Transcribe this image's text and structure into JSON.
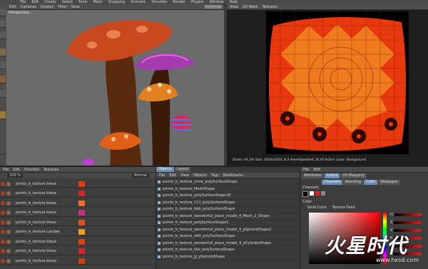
{
  "top_menu": [
    "File",
    "Edit",
    "Create",
    "Select",
    "Tools",
    "Mesh",
    "Snapping",
    "Animate",
    "Simulate",
    "Render",
    "Plugins",
    "Window",
    "Help"
  ],
  "viewport": {
    "menu": [
      "Edit",
      "Cameras",
      "Display",
      "Filter",
      "View"
    ],
    "label": "Perspective"
  },
  "uv_panel": {
    "menu": [
      "View",
      "UV Mesh",
      "Textures"
    ],
    "status": "Zoom: 44.2%  Size: 1024x1024, 8.3  AmeeSperble4_1k.tif  Active Layer: Background"
  },
  "layers_panel": {
    "menu": [
      "File",
      "Edit",
      "Function",
      "Textures"
    ],
    "zoom": "100 %",
    "mode": "Normal",
    "rows": [
      "points_b_texture bleue",
      "points_b_texture bleue",
      "points_b_texture bleue",
      "points_b_texture bleue",
      "points_b_texture bleue",
      "points_b_texture Lamber",
      "points_b_texture bleue",
      "points_b_texture bleue",
      "points_b_texture bleue"
    ]
  },
  "objects_panel": {
    "tabs": [
      "Objects",
      "Layers"
    ],
    "menu": [
      "File",
      "Edit",
      "View",
      "Objects",
      "Tags",
      "Bookmarks"
    ],
    "items": [
      "points_b_texture_mme_polySurfaceShape",
      "points_b_texture_MeshShape",
      "points_b_texture_polySurfaceShape30",
      "points_b_texture_111_polySurfaceShape",
      "points_b_texture_bbb_polySurfaceShape",
      "points_b_texture_wonderfull_place_model_4_Mesh_2_Shape",
      "points_b_texture_polySurfaceShape1",
      "points_b_texture_wonderfull_place_model_4_pSphereShape2",
      "points_b_texture_ddd_polySurfaceShape",
      "points_b_texture_wonderfull_place_model_4_pCylinderShape",
      "points_b_texture_kkk_polySurfaceShape",
      "points_b_texture_jjj_pSphereShape"
    ]
  },
  "attr_panel": {
    "menu": [
      "File",
      "Edit"
    ],
    "tabs": [
      "Attributes",
      "Colors",
      "UV Mapping"
    ],
    "subtabs": [
      "Channels",
      "Blending",
      "Color",
      "Wallpaper"
    ],
    "channels_label": "Channels",
    "color_label": "Color",
    "color_mode": "Solid Color",
    "texture_label": "Texture Paint",
    "fields": [
      "H",
      "S",
      "V",
      "R",
      "G",
      "B"
    ]
  },
  "watermark": {
    "text": "火星时代",
    "url": "www.hxsd.com"
  }
}
